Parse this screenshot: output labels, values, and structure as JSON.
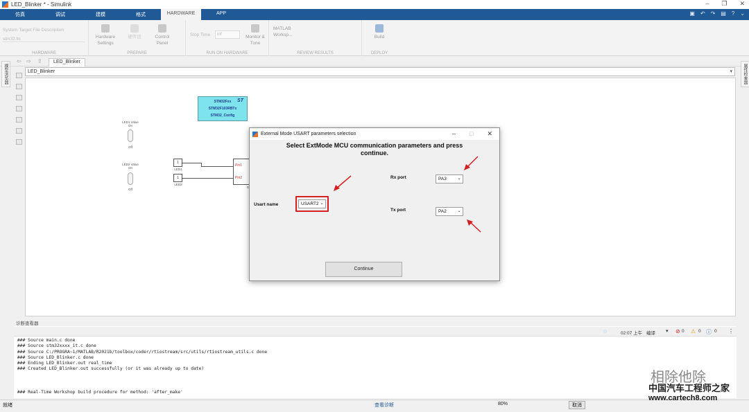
{
  "window": {
    "title": "LED_Blinker * - Simulink"
  },
  "tabs": [
    "仿真",
    "调试",
    "建模",
    "格式",
    "HARDWARE",
    "APP"
  ],
  "ribbon": {
    "system_target_label": "System Target File Description",
    "system_target_value": "stm32.tlc",
    "hardware_settings": "Hardware Settings",
    "control_panel": "Control Panel",
    "stop_time_label": "Stop Time",
    "stop_time_value": "inf",
    "monitor_tune": "Monitor & Tune",
    "matlab_workspace": "MATLAB Worksp...",
    "build": "Build",
    "groups": [
      "HARDWARE",
      "PREPARE",
      "RUN ON HARDWARE",
      "REVIEW RESULTS",
      "DEPLOY"
    ],
    "faded_btn": "硬件设"
  },
  "doc": {
    "tab": "LED_Blinker",
    "breadcrumb": "LED_Blinker"
  },
  "side": {
    "left": "模型浏览器",
    "right": "属性检查器"
  },
  "canvas": {
    "stm_block": [
      "STM32Fxx",
      "STM32F103RBTx",
      "STM32_Config"
    ],
    "st_logo": "ST",
    "led1_value": "LED1 Value",
    "led2_value": "LED2 Value",
    "on": "On",
    "off": "Off",
    "const1": "1",
    "const2": "1",
    "led1": "LED1",
    "led2": "LED2",
    "pin1": "Pin1",
    "pin2": "Pin2",
    "gp": "GP"
  },
  "dialog": {
    "title": "External Mode USART parameters selection",
    "heading": "Select ExtMode MCU communication parameters and press continue.",
    "usart_label": "Usart name",
    "usart_value": "USART2",
    "rx_label": "Rx port",
    "rx_value": "PA3",
    "tx_label": "Tx port",
    "tx_value": "PA2",
    "continue": "Continue"
  },
  "diagnostics": {
    "header": "诊断查看器",
    "time": "02:07 上午",
    "build_label": "编译",
    "errors": "0",
    "warnings": "0",
    "infos": "0",
    "log": [
      "### Source main.c done",
      "### Source stm32xxxx_it.c done",
      "### Source C:/PROGRA~1/MATLAB/R2021b/toolbox/coder/rtiostream/src/utils/rtiostream_utils.c done",
      "### Source LED_Blinker.c done",
      "### Ending LED_Blinker.out real_time",
      "### Created LED_Blinker.out successfully (or it was already up to date)",
      "",
      "",
      "",
      "### Real-Time Workshop build procedure for method: 'after_make'"
    ]
  },
  "status": {
    "left": "就绪",
    "center": "查看诊断",
    "zoom": "80%",
    "cancel": "取消"
  },
  "watermark": {
    "line1": "相除他除",
    "line2": "中国汽车工程师之家",
    "line3": "www.cartech8.com"
  },
  "colors": {
    "accent": "#1f5a96",
    "highlight": "#d32020"
  }
}
